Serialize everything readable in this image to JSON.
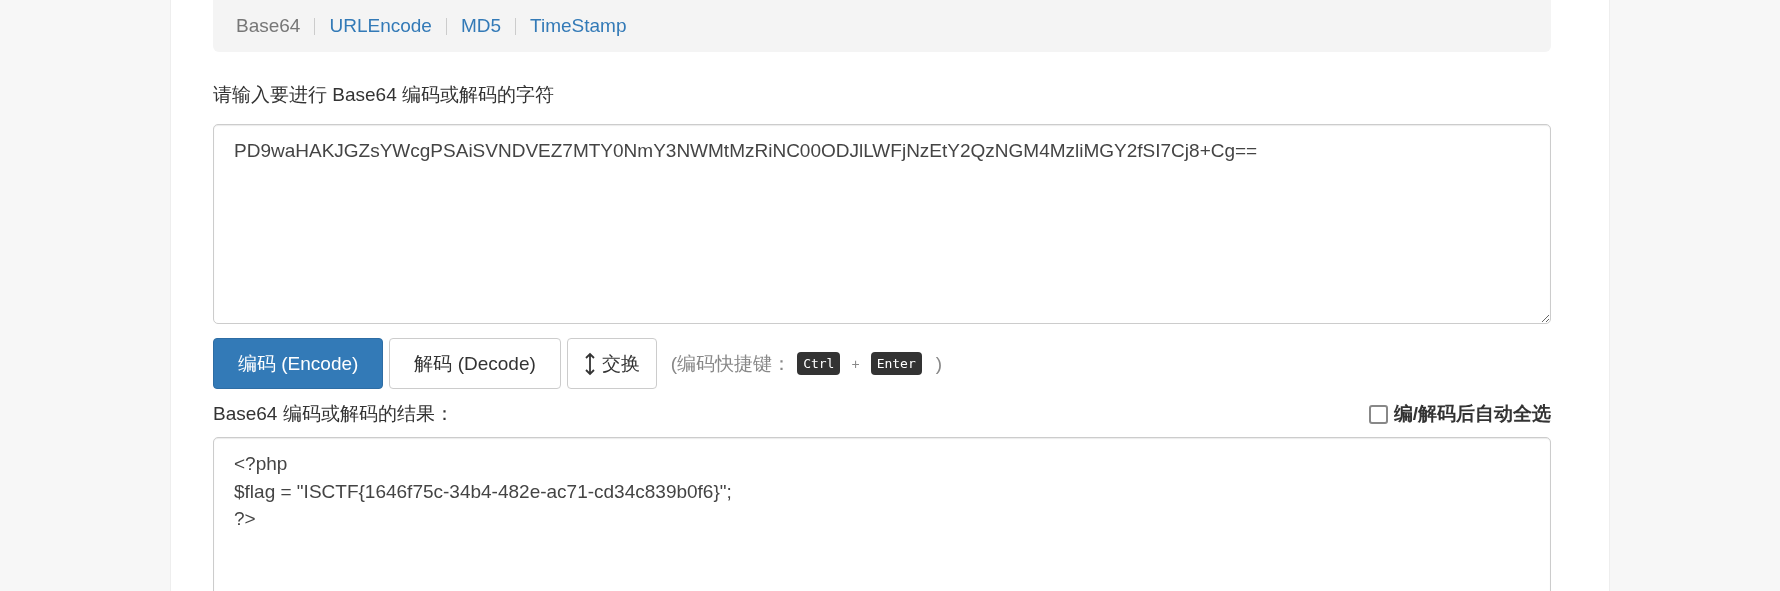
{
  "nav": [
    {
      "label": "Base64",
      "selected": true
    },
    {
      "label": "URLEncode",
      "selected": false
    },
    {
      "label": "MD5",
      "selected": false
    },
    {
      "label": "TimeStamp",
      "selected": false
    }
  ],
  "input_label": "请输入要进行 Base64 编码或解码的字符",
  "input": {
    "value": "PD9waHAKJGZsYWcgPSAiSVNDVEZ7MTY0NmY3NWMtMzRiNC00ODJlLWFjNzEtY2QzNGM4MzliMGY2fSI7Cj8+Cg=="
  },
  "buttons": [
    {
      "kind": "primary",
      "label": "编码 (Encode)"
    },
    {
      "kind": "default",
      "label": "解码 (Decode)"
    },
    {
      "kind": "swap",
      "label": "交换"
    }
  ],
  "shortcut": {
    "prefix": "(编码快捷键：",
    "keys": [
      "Ctrl",
      "Enter"
    ],
    "joiner": "+",
    "suffix": ")"
  },
  "result_label": "Base64 编码或解码的结果：",
  "auto_select": {
    "label": "编/解码后自动全选",
    "checked": false
  },
  "output": {
    "lines": [
      "<?php",
      "$flag = \"ISCTF{1646f75c-34b4-482e-ac71-cd34c839b0f6}\";",
      "?>"
    ]
  }
}
